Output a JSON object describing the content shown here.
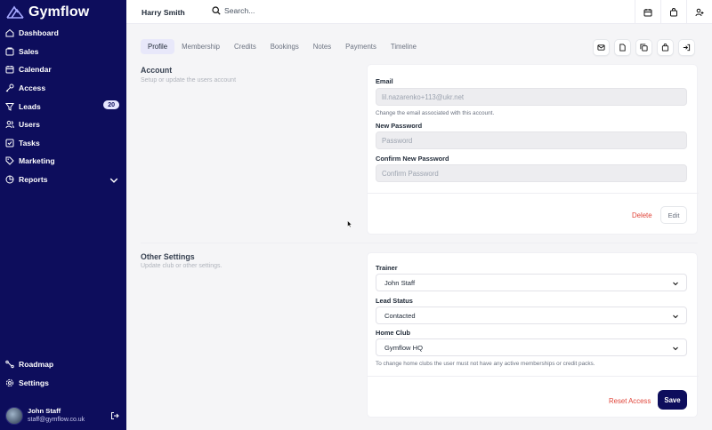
{
  "app": {
    "name": "Gymflow"
  },
  "sidebar": {
    "items": [
      {
        "label": "Dashboard",
        "icon": "home-icon"
      },
      {
        "label": "Sales",
        "icon": "sales-icon"
      },
      {
        "label": "Calendar",
        "icon": "calendar-icon"
      },
      {
        "label": "Access",
        "icon": "key-icon"
      },
      {
        "label": "Leads",
        "icon": "filter-icon",
        "badge": "20"
      },
      {
        "label": "Users",
        "icon": "users-icon"
      },
      {
        "label": "Tasks",
        "icon": "tasks-icon"
      },
      {
        "label": "Marketing",
        "icon": "tag-icon"
      },
      {
        "label": "Reports",
        "icon": "pie-chart-icon"
      }
    ],
    "bottom_items": [
      {
        "label": "Roadmap",
        "icon": "roadmap-icon"
      },
      {
        "label": "Settings",
        "icon": "gear-icon"
      }
    ],
    "user": {
      "name": "John Staff",
      "email": "staff@gymflow.co.uk"
    }
  },
  "topbar": {
    "user_name": "Harry Smith",
    "search_placeholder": "Search..."
  },
  "tabs": [
    "Profile",
    "Membership",
    "Credits",
    "Bookings",
    "Notes",
    "Payments",
    "Timeline"
  ],
  "account": {
    "title": "Account",
    "subtitle": "Setup or update the users account",
    "email_label": "Email",
    "email_value": "lil.nazarenko+113@ukr.net",
    "email_hint": "Change the email associated with this account.",
    "new_password_label": "New Password",
    "new_password_placeholder": "Password",
    "confirm_password_label": "Confirm New Password",
    "confirm_password_placeholder": "Confirm Password",
    "delete_label": "Delete",
    "edit_label": "Edit"
  },
  "other_settings": {
    "title": "Other Settings",
    "subtitle": "Update club or other settings.",
    "trainer_label": "Trainer",
    "trainer_value": "John Staff",
    "lead_status_label": "Lead Status",
    "lead_status_value": "Contacted",
    "home_club_label": "Home Club",
    "home_club_value": "Gymflow HQ",
    "home_club_hint": "To change home clubs the user must not have any active memberships or credit packs.",
    "reset_access_label": "Reset Access",
    "save_label": "Save"
  },
  "colors": {
    "sidebar": "#0d0d5c",
    "danger": "#e0453a",
    "tab_active": "#e8e8fa"
  }
}
